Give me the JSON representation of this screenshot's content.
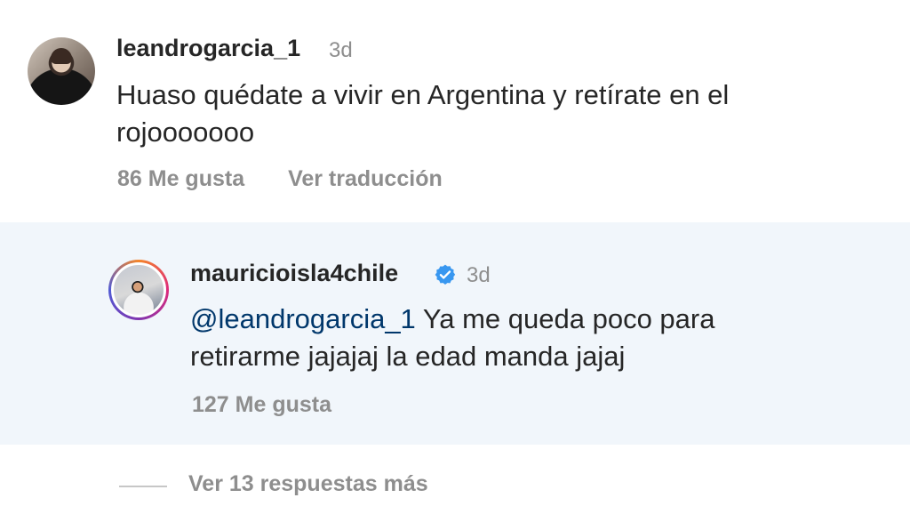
{
  "comment": {
    "username": "leandrogarcia_1",
    "time": "3d",
    "text": "Huaso quédate a vivir en Argentina y retírate en el rojooooooo",
    "likes": "86 Me gusta",
    "translate": "Ver traducción",
    "avatar_icon": "profile-photo-icon"
  },
  "reply": {
    "username": "mauricioisla4chile",
    "verified_icon": "verified-badge-icon",
    "time": "3d",
    "mention": "@leandrogarcia_1",
    "text": " Ya me queda poco para retirarme jajajaj la edad manda jajaj",
    "likes": "127 Me gusta",
    "avatar_icon": "story-ring-profile-photo-icon",
    "verified_color": "#3897f0"
  },
  "footer": {
    "view_more": "Ver 13 respuestas más"
  },
  "colors": {
    "text": "#262626",
    "muted": "#8e8e8e",
    "mention": "#00376b",
    "reply_bg": "#f1f6fb"
  }
}
